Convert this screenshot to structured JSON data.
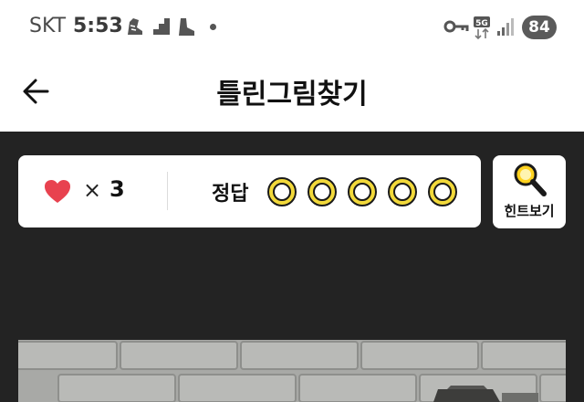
{
  "status_bar": {
    "carrier": "SKT",
    "time": "5:53",
    "network": "5G",
    "battery": "84"
  },
  "header": {
    "title": "틀린그림찾기",
    "back_icon": "arrow-left-icon"
  },
  "game_info": {
    "lives_icon": "heart-icon",
    "lives_multiplier": "×",
    "lives": "3",
    "answer_label": "정답",
    "answers_total": 5,
    "answers_found": 0
  },
  "hint": {
    "icon": "magnifier-icon",
    "label": "힌트보기"
  },
  "colors": {
    "background": "#232323",
    "heart": "#e8424f",
    "answer_ring": "#f2d93a",
    "hint_icon": "#f2c400"
  }
}
